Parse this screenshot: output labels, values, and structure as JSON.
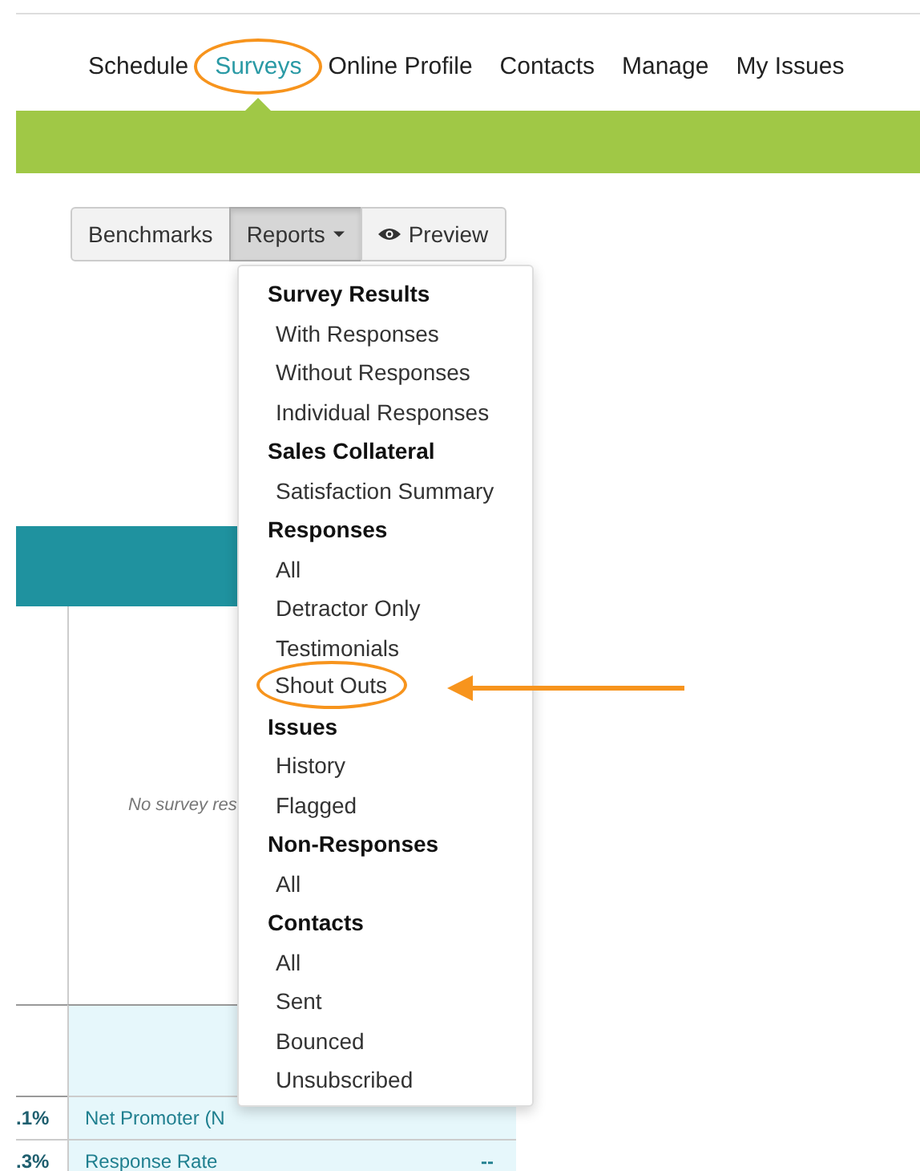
{
  "nav": {
    "items": [
      {
        "label": "Schedule",
        "selected": false,
        "circled": false
      },
      {
        "label": "Surveys",
        "selected": true,
        "circled": true
      },
      {
        "label": "Online Profile",
        "selected": false,
        "circled": false
      },
      {
        "label": "Contacts",
        "selected": false,
        "circled": false
      },
      {
        "label": "Manage",
        "selected": false,
        "circled": false
      },
      {
        "label": "My Issues",
        "selected": false,
        "circled": false
      }
    ]
  },
  "toolbar": {
    "buttons": [
      {
        "label": "Benchmarks",
        "kind": "plain",
        "selected": false
      },
      {
        "label": "Reports",
        "kind": "dropdown",
        "selected": true
      },
      {
        "label": "Preview",
        "kind": "eye",
        "selected": false
      }
    ]
  },
  "reports_menu": {
    "sections": [
      {
        "heading": "Survey Results",
        "items": [
          {
            "label": "With Responses",
            "circled": false
          },
          {
            "label": "Without Responses",
            "circled": false
          },
          {
            "label": "Individual Responses",
            "circled": false
          }
        ]
      },
      {
        "heading": "Sales Collateral",
        "items": [
          {
            "label": "Satisfaction Summary",
            "circled": false
          }
        ]
      },
      {
        "heading": "Responses",
        "items": [
          {
            "label": "All",
            "circled": false
          },
          {
            "label": "Detractor Only",
            "circled": false
          },
          {
            "label": "Testimonials",
            "circled": false
          },
          {
            "label": "Shout Outs",
            "circled": true
          }
        ]
      },
      {
        "heading": "Issues",
        "items": [
          {
            "label": "History",
            "circled": false
          },
          {
            "label": "Flagged",
            "circled": false
          }
        ]
      },
      {
        "heading": "Non-Responses",
        "items": [
          {
            "label": "All",
            "circled": false
          }
        ]
      },
      {
        "heading": "Contacts",
        "items": [
          {
            "label": "All",
            "circled": false
          },
          {
            "label": "Sent",
            "circled": false
          },
          {
            "label": "Bounced",
            "circled": false
          },
          {
            "label": "Unsubscribed",
            "circled": false
          }
        ]
      }
    ]
  },
  "table": {
    "empty_message": "No survey res",
    "rows": [
      {
        "column_1": ".1%",
        "column_2": "Net Promoter (N"
      },
      {
        "column_1": ".3%",
        "column_2": "Response Rate",
        "column_3": "--"
      }
    ]
  }
}
